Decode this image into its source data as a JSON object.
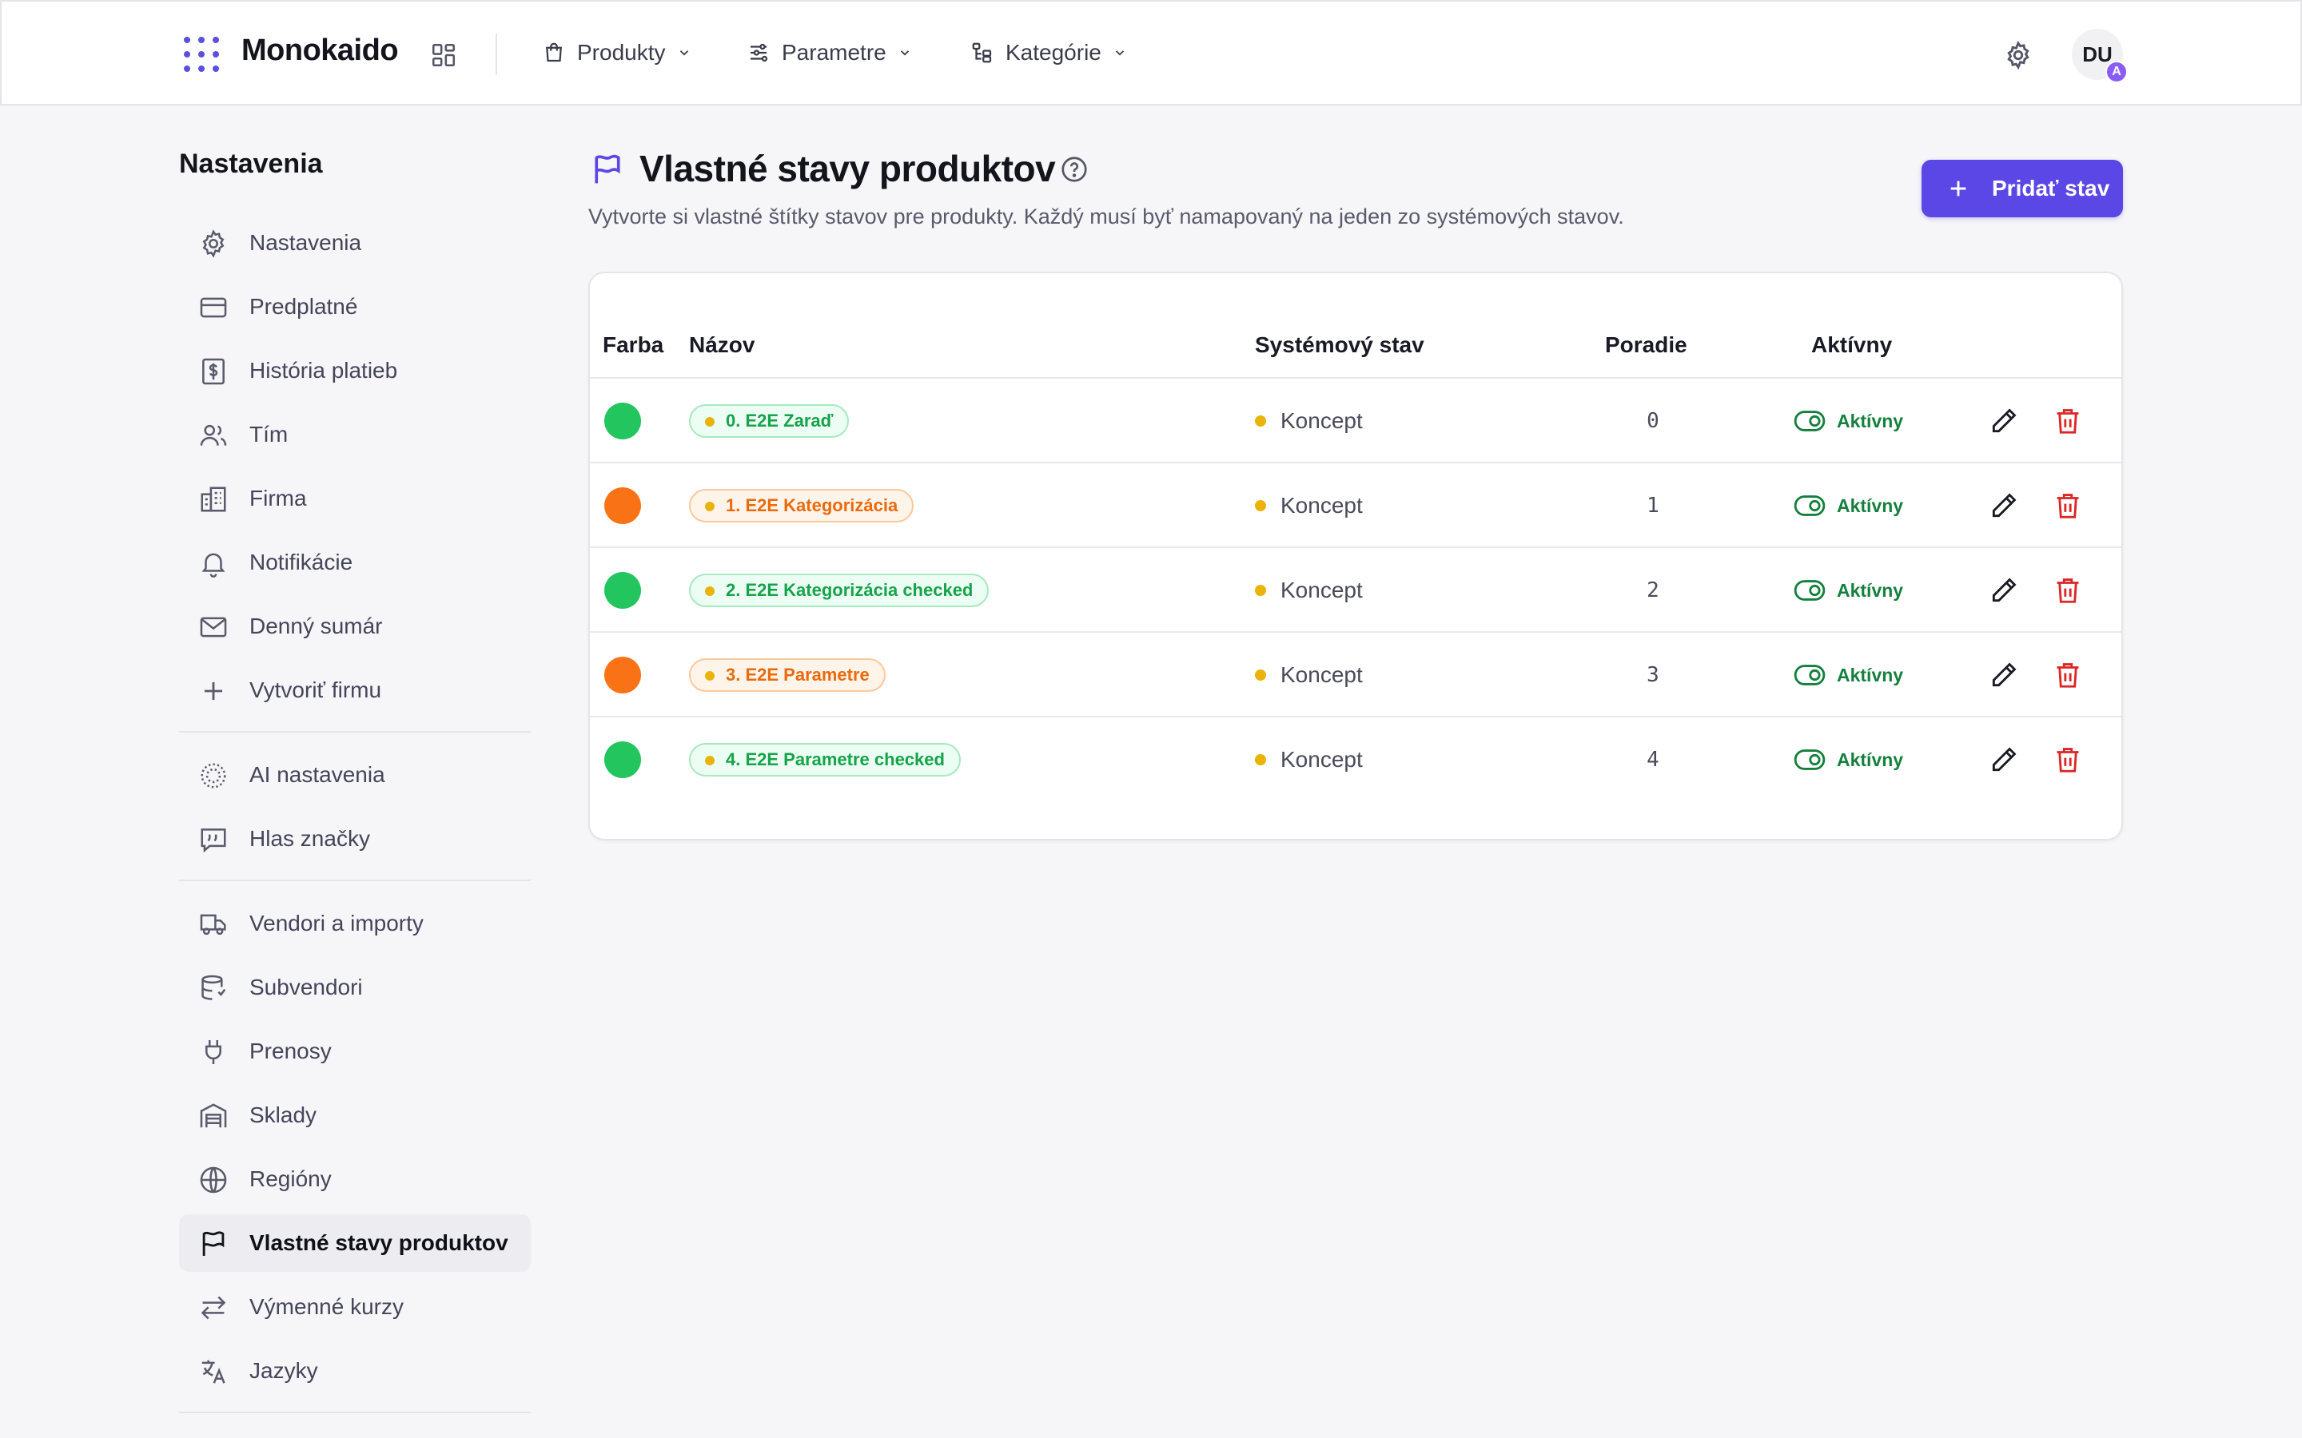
{
  "app": {
    "name": "Monokaido",
    "nav": [
      {
        "label": "Produkty",
        "icon": "shopping-bag-icon"
      },
      {
        "label": "Parametre",
        "icon": "sliders-icon"
      },
      {
        "label": "Kategórie",
        "icon": "category-tree-icon"
      }
    ],
    "avatar_initials": "DU",
    "avatar_badge": "A"
  },
  "sidebar": {
    "title": "Nastavenia",
    "groups": [
      [
        {
          "label": "Nastavenia",
          "icon": "gear-icon"
        },
        {
          "label": "Predplatné",
          "icon": "credit-card-icon"
        },
        {
          "label": "História platieb",
          "icon": "receipt-dollar-icon"
        },
        {
          "label": "Tím",
          "icon": "users-icon"
        },
        {
          "label": "Firma",
          "icon": "building-icon"
        },
        {
          "label": "Notifikácie",
          "icon": "bell-icon"
        },
        {
          "label": "Denný sumár",
          "icon": "mail-icon"
        },
        {
          "label": "Vytvoriť firmu",
          "icon": "plus-icon"
        }
      ],
      [
        {
          "label": "AI nastavenia",
          "icon": "ai-sparkle-icon"
        },
        {
          "label": "Hlas značky",
          "icon": "quote-message-icon"
        }
      ],
      [
        {
          "label": "Vendori a importy",
          "icon": "truck-icon"
        },
        {
          "label": "Subvendori",
          "icon": "database-icon"
        },
        {
          "label": "Prenosy",
          "icon": "plug-icon"
        },
        {
          "label": "Sklady",
          "icon": "warehouse-icon"
        },
        {
          "label": "Regióny",
          "icon": "globe-icon"
        },
        {
          "label": "Vlastné stavy produktov",
          "icon": "flag-icon",
          "active": true
        },
        {
          "label": "Výmenné kurzy",
          "icon": "exchange-arrows-icon"
        },
        {
          "label": "Jazyky",
          "icon": "translate-icon"
        }
      ]
    ]
  },
  "page": {
    "title": "Vlastné stavy produktov",
    "subtitle": "Vytvorte si vlastné štítky stavov pre produkty. Každý musí byť namapovaný na jeden zo systémových stavov.",
    "add_button": "Pridať stav"
  },
  "table": {
    "headers": {
      "color": "Farba",
      "name": "Názov",
      "system": "Systémový stav",
      "order": "Poradie",
      "active": "Aktívny"
    },
    "rows": [
      {
        "color": "#22c55e",
        "tone": "green",
        "name": "0. E2E Zaraď",
        "system": "Koncept",
        "order": "0",
        "active": "Aktívny"
      },
      {
        "color": "#f97316",
        "tone": "orange",
        "name": "1. E2E Kategorizácia",
        "system": "Koncept",
        "order": "1",
        "active": "Aktívny"
      },
      {
        "color": "#22c55e",
        "tone": "green",
        "name": "2. E2E Kategorizácia checked",
        "system": "Koncept",
        "order": "2",
        "active": "Aktívny"
      },
      {
        "color": "#f97316",
        "tone": "orange",
        "name": "3. E2E Parametre",
        "system": "Koncept",
        "order": "3",
        "active": "Aktívny"
      },
      {
        "color": "#22c55e",
        "tone": "green",
        "name": "4. E2E Parametre checked",
        "system": "Koncept",
        "order": "4",
        "active": "Aktívny"
      }
    ]
  },
  "colors": {
    "accent": "#5b47e6",
    "green": "#22c55e",
    "orange": "#f97316",
    "status_dot": "#eab308",
    "active_text": "#15803d",
    "delete": "#dc2626"
  }
}
